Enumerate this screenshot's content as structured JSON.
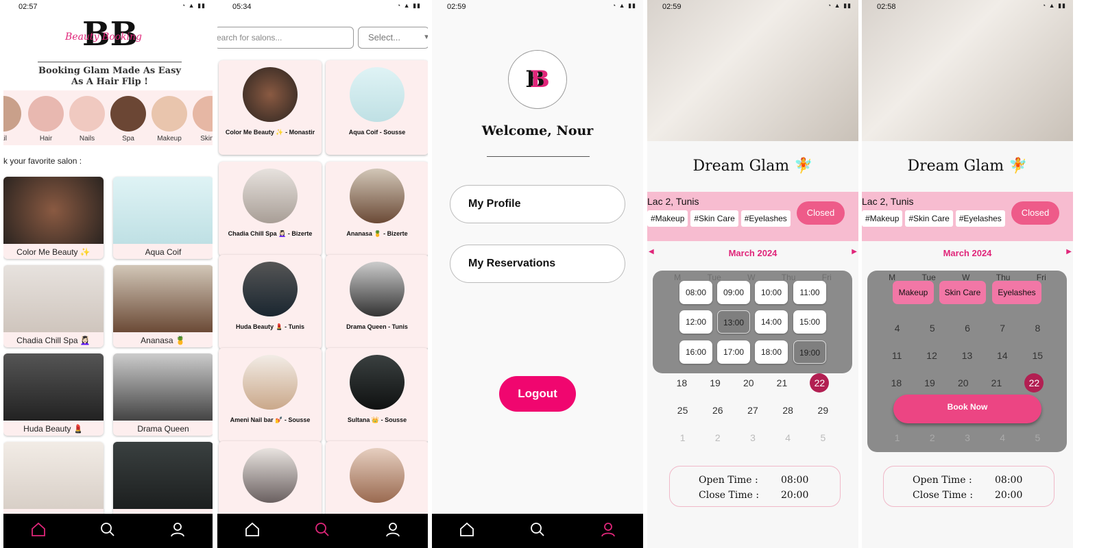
{
  "screens": {
    "home": {
      "time": "02:57",
      "tagline": "Booking Glam Made As Easy As A Hair Flip !",
      "section": "k your favorite salon :",
      "categories": [
        "ail",
        "Hair",
        "Nails",
        "Spa",
        "Makeup",
        "Skin C"
      ],
      "salons": [
        "Color Me Beauty ✨",
        "Aqua Coif",
        "Chadia Chill Spa 💆🏻‍♀️",
        "Ananasa 🍍",
        "Huda Beauty 💄",
        "Drama Queen"
      ]
    },
    "search": {
      "time": "05:34",
      "placeholder": "earch for salons...",
      "select": "Select...",
      "salons": [
        "Color Me Beauty ✨ - Monastir",
        "Aqua Coif  - Sousse",
        "Chadia Chill Spa 💆🏻‍♀️ - Bizerte",
        "Ananasa 🍍 - Bizerte",
        "Huda Beauty 💄 - Tunis",
        "Drama Queen - Tunis",
        "Ameni Nail bar 💅 - Sousse",
        "Sultana 👑 - Sousse"
      ]
    },
    "profile": {
      "time": "02:59",
      "welcome": "Welcome, Nour",
      "my_profile": "My Profile",
      "my_reservations": "My Reservations",
      "logout": "Logout"
    },
    "detail": {
      "time_a": "02:59",
      "time_b": "02:58",
      "name": "Dream Glam 🧚",
      "location": "Lac 2, Tunis",
      "tags": [
        "#Makeup",
        "#Skin Care",
        "#Eyelashes"
      ],
      "status": "Closed",
      "month": "March 2024",
      "weekdays": [
        "M",
        "Tue",
        "W",
        "Thu",
        "Fri"
      ],
      "rows": [
        [
          "4",
          "5",
          "6",
          "7",
          "8"
        ],
        [
          "11",
          "12",
          "13",
          "14",
          "15"
        ],
        [
          "18",
          "19",
          "20",
          "21",
          "22"
        ],
        [
          "25",
          "26",
          "27",
          "28",
          "29"
        ],
        [
          "1",
          "2",
          "3",
          "4",
          "5"
        ]
      ],
      "slots": [
        "08:00",
        "09:00",
        "10:00",
        "11:00",
        "12:00",
        "13:00",
        "14:00",
        "15:00",
        "16:00",
        "17:00",
        "18:00",
        "19:00"
      ],
      "services": [
        "Makeup",
        "Skin Care",
        "Eyelashes"
      ],
      "book": "Book Now",
      "open_label": "Open Time :",
      "open": "08:00",
      "close_label": "Close Time :",
      "close": "20:00"
    }
  },
  "colors": {
    "pink": "#e0267a",
    "light_pink": "#fdeeee",
    "band": "#f7bcd0"
  }
}
